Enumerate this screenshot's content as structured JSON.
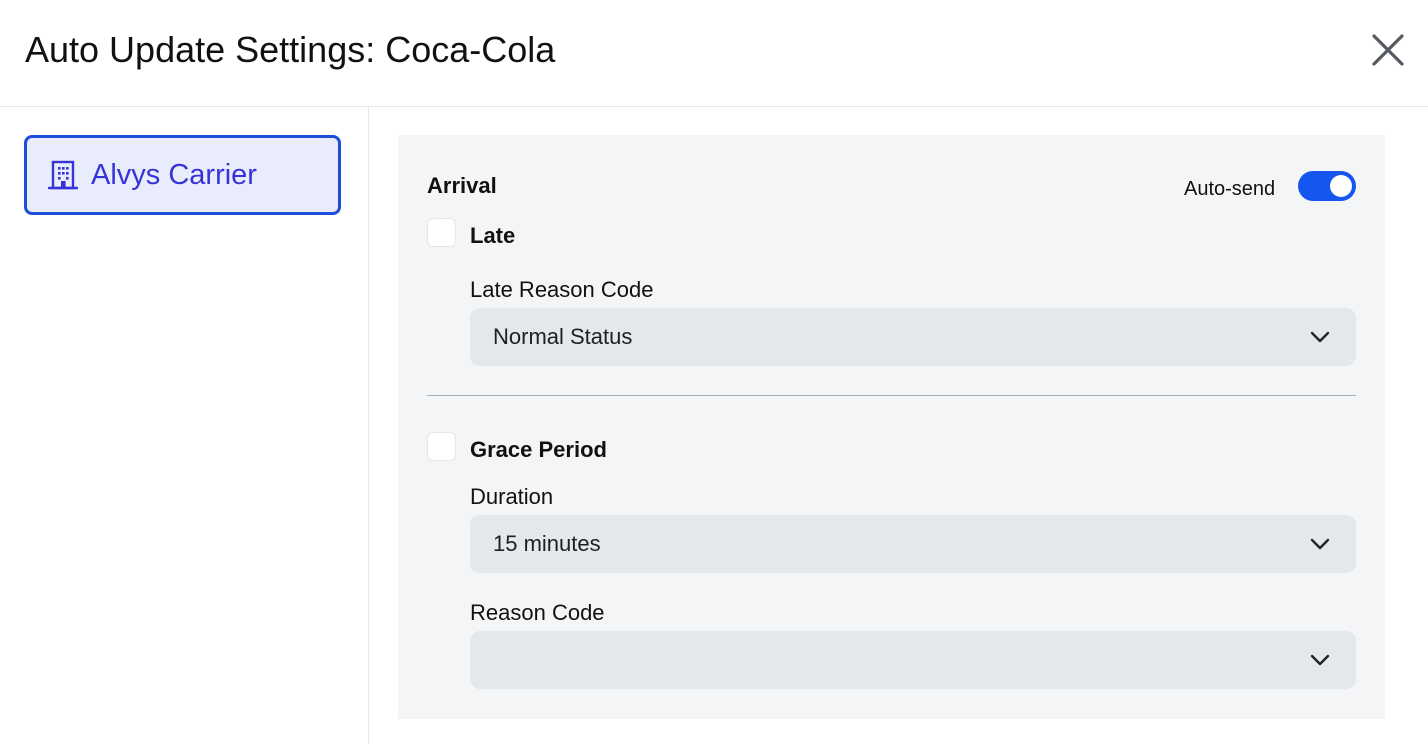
{
  "header": {
    "title": "Auto Update Settings: Coca-Cola",
    "close_icon": "close-icon"
  },
  "sidebar": {
    "items": [
      {
        "label": "Alvys Carrier",
        "icon": "building-icon",
        "selected": true
      }
    ]
  },
  "arrival": {
    "title": "Arrival",
    "auto_send_label": "Auto-send",
    "auto_send_enabled": true,
    "late": {
      "label": "Late",
      "checked": false,
      "reason_code_label": "Late Reason Code",
      "reason_code_value": "Normal Status"
    },
    "grace_period": {
      "label": "Grace Period",
      "checked": false,
      "duration_label": "Duration",
      "duration_value": "15 minutes",
      "reason_code_label": "Reason Code",
      "reason_code_value": ""
    }
  },
  "colors": {
    "accent": "#1656f0",
    "selected_border": "#1d4fd8",
    "selected_bg": "#e8ecfb",
    "selected_text": "#3634d9",
    "panel_bg": "#f4f5f7",
    "select_bg": "#e4e7eb"
  }
}
